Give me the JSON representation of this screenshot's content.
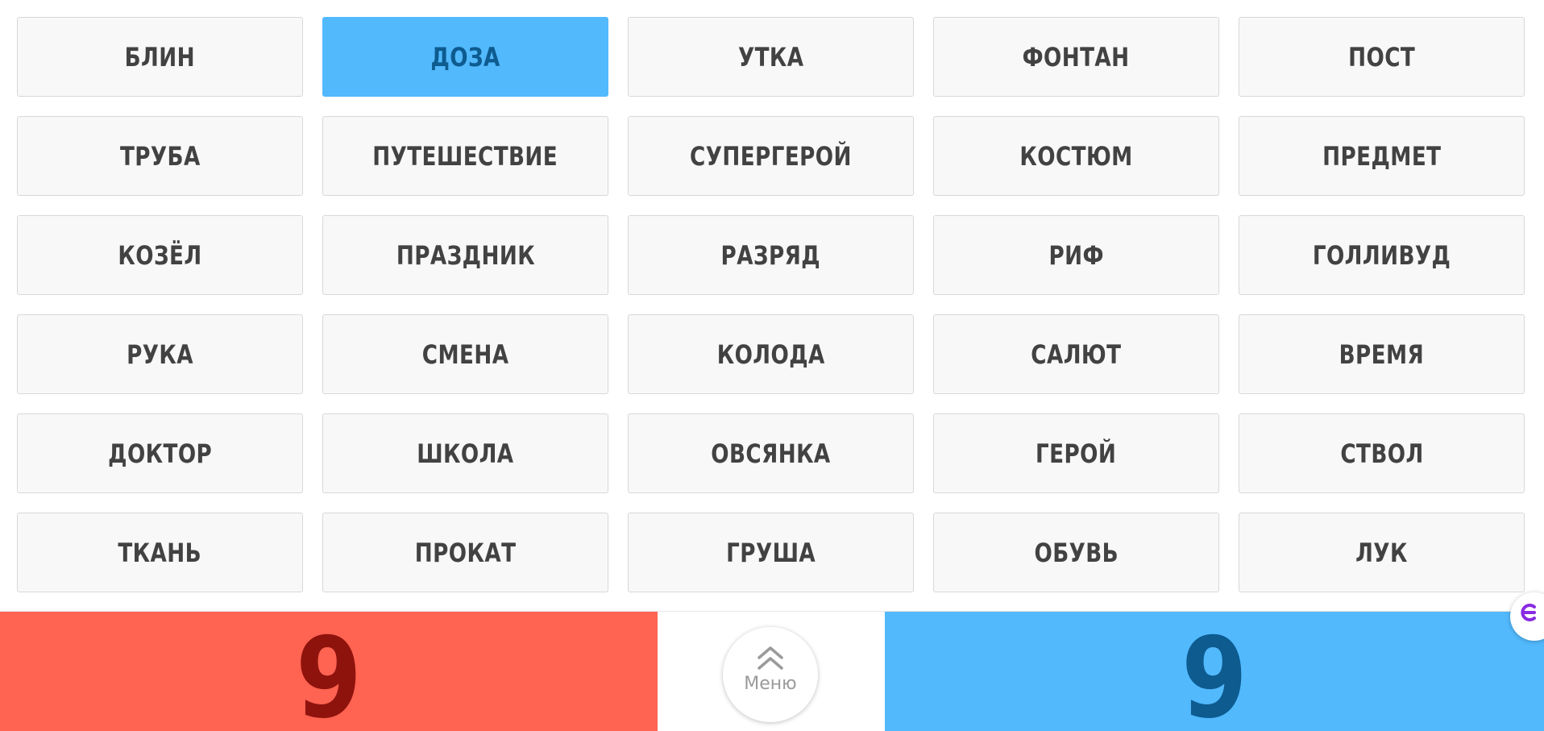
{
  "board": {
    "cards": [
      {
        "word": "БЛИН",
        "selected": false
      },
      {
        "word": "ДОЗА",
        "selected": true
      },
      {
        "word": "УТКА",
        "selected": false
      },
      {
        "word": "ФОНТАН",
        "selected": false
      },
      {
        "word": "ПОСТ",
        "selected": false
      },
      {
        "word": "ТРУБА",
        "selected": false
      },
      {
        "word": "ПУТЕШЕСТВИЕ",
        "selected": false
      },
      {
        "word": "СУПЕРГЕРОЙ",
        "selected": false
      },
      {
        "word": "КОСТЮМ",
        "selected": false
      },
      {
        "word": "ПРЕДМЕТ",
        "selected": false
      },
      {
        "word": "КОЗЁЛ",
        "selected": false
      },
      {
        "word": "ПРАЗДНИК",
        "selected": false
      },
      {
        "word": "РАЗРЯД",
        "selected": false
      },
      {
        "word": "РИФ",
        "selected": false
      },
      {
        "word": "ГОЛЛИВУД",
        "selected": false
      },
      {
        "word": "РУКА",
        "selected": false
      },
      {
        "word": "СМЕНА",
        "selected": false
      },
      {
        "word": "КОЛОДА",
        "selected": false
      },
      {
        "word": "САЛЮТ",
        "selected": false
      },
      {
        "word": "ВРЕМЯ",
        "selected": false
      },
      {
        "word": "ДОКТОР",
        "selected": false
      },
      {
        "word": "ШКОЛА",
        "selected": false
      },
      {
        "word": "ОВСЯНКА",
        "selected": false
      },
      {
        "word": "ГЕРОЙ",
        "selected": false
      },
      {
        "word": "СТВОЛ",
        "selected": false
      },
      {
        "word": "ТКАНЬ",
        "selected": false
      },
      {
        "word": "ПРОКАТ",
        "selected": false
      },
      {
        "word": "ГРУША",
        "selected": false
      },
      {
        "word": "ОБУВЬ",
        "selected": false
      },
      {
        "word": "ЛУК",
        "selected": false
      }
    ]
  },
  "footer": {
    "red_score": "9",
    "blue_score": "9",
    "menu_label": "Меню",
    "menu_icon": "double-chevron-up-icon"
  },
  "colors": {
    "red_team": "#ff6351",
    "red_score": "#8f130d",
    "blue_team": "#52b9fd",
    "blue_score": "#0d5b8f",
    "card_bg": "#f8f8f8",
    "card_text": "#424242"
  }
}
